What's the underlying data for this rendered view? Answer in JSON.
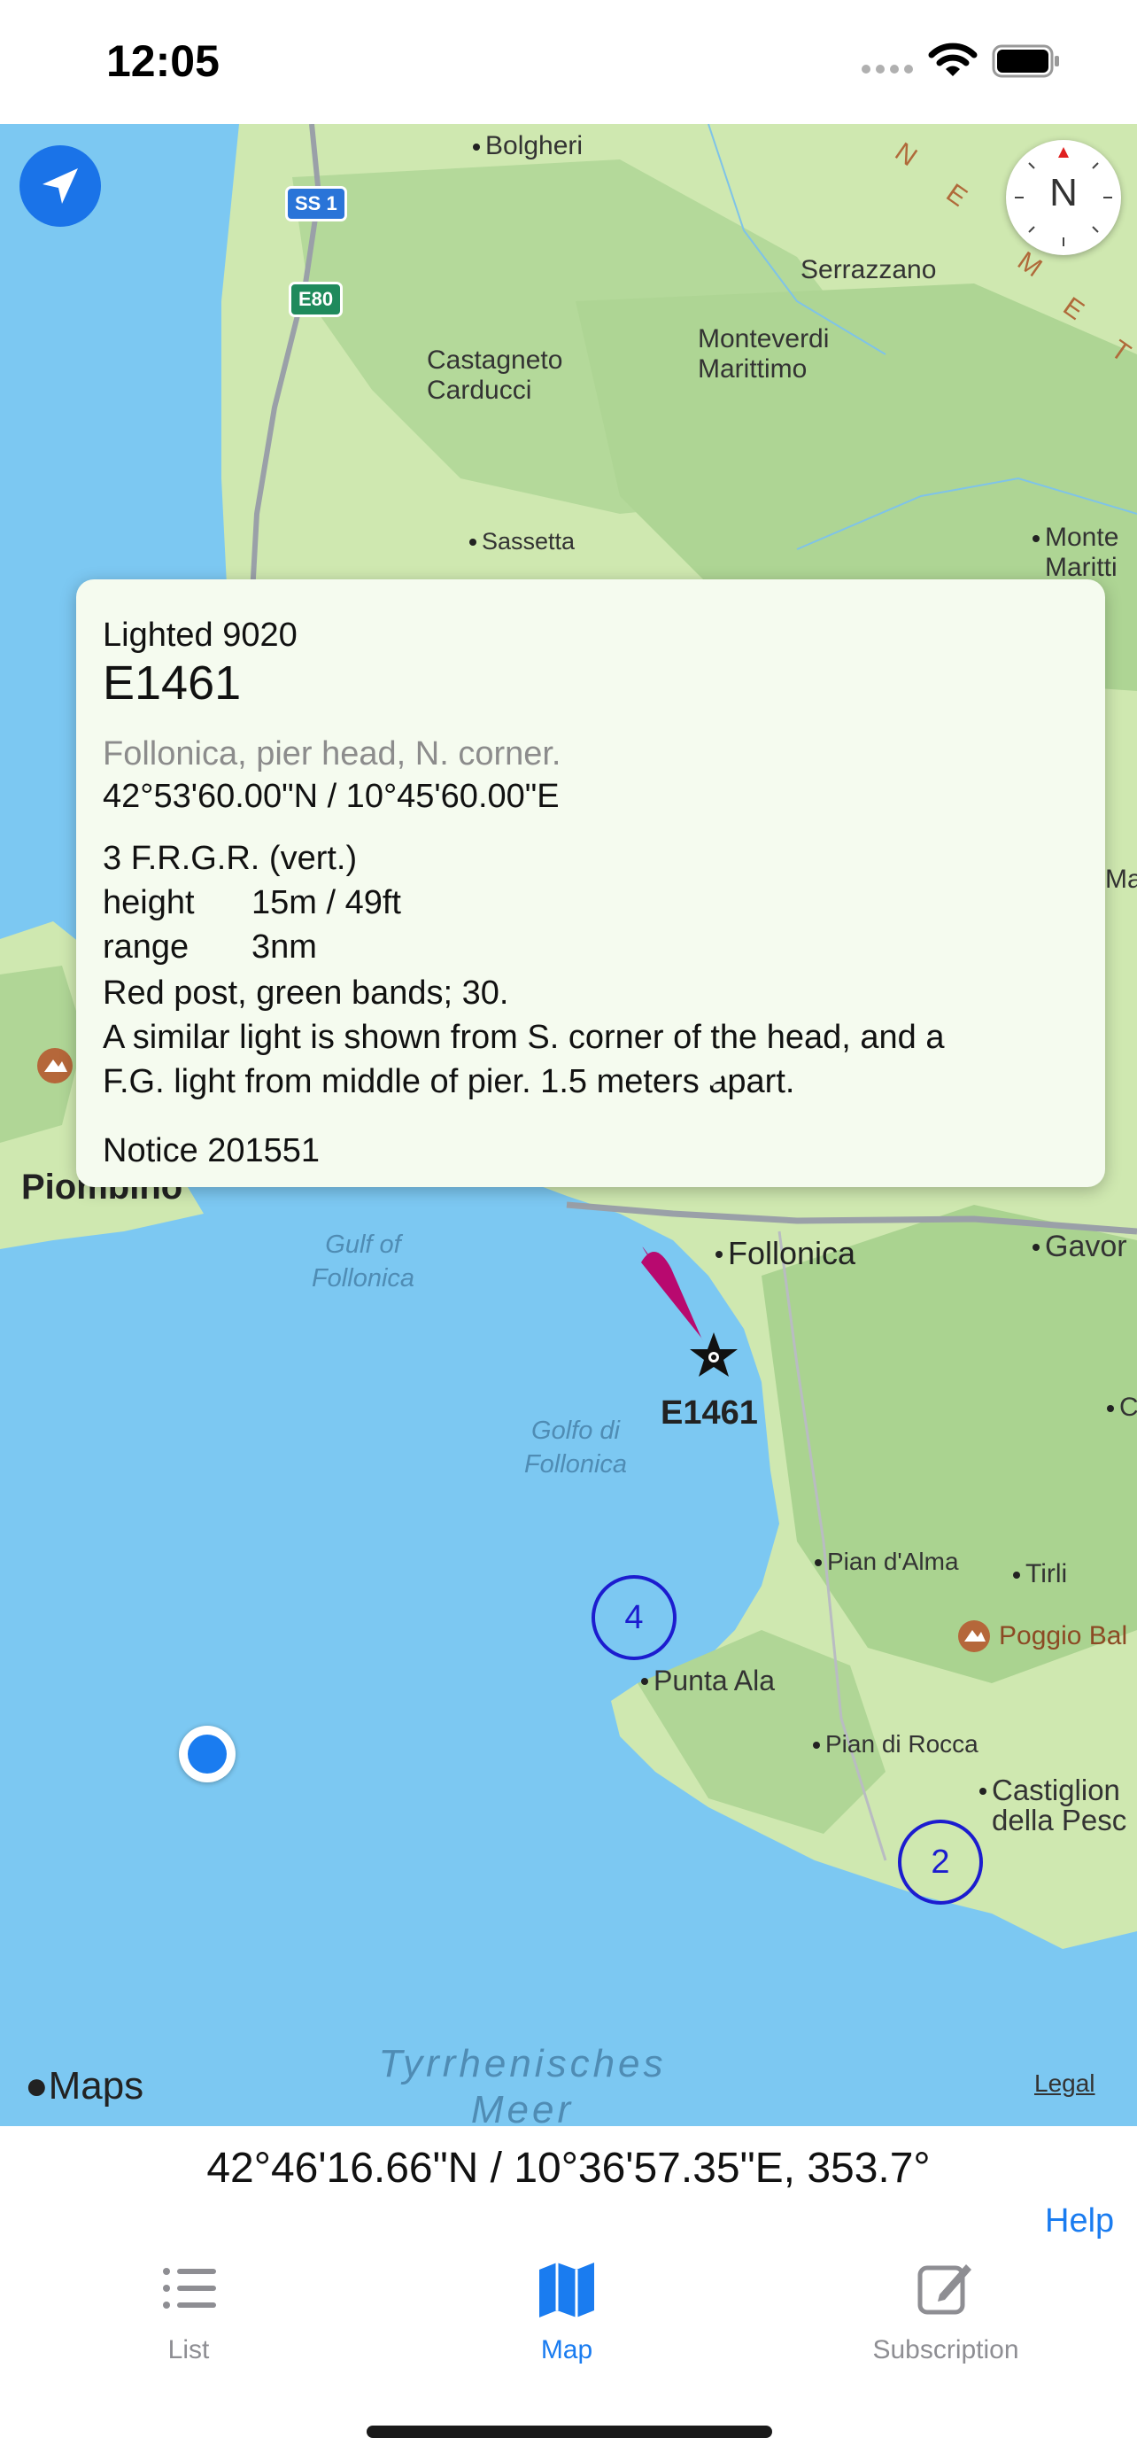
{
  "status_bar": {
    "time": "12:05"
  },
  "map": {
    "places": [
      {
        "name": "Bolgheri"
      },
      {
        "name": "Serrazzano"
      },
      {
        "name": "Castagneto\nCarducci"
      },
      {
        "name": "Monteverdi\nMarittimo"
      },
      {
        "name": "Sassetta"
      },
      {
        "name": "Monte\nMaritti"
      },
      {
        "name": "Follonica"
      },
      {
        "name": "Gavor"
      },
      {
        "name": "Pian d'Alma"
      },
      {
        "name": "Tirli"
      },
      {
        "name": "Poggio Bal"
      },
      {
        "name": "Punta Ala"
      },
      {
        "name": "Pian di Rocca"
      },
      {
        "name": "Castiglion\ndella Pesc"
      },
      {
        "name": "Ma"
      },
      {
        "name": "C"
      }
    ],
    "region_letters": [
      "N",
      "E",
      "M",
      "E",
      "T"
    ],
    "piombino": "Piombino",
    "water_labels": [
      "Gulf of\nFollonica",
      "Golfo di\nFollonica",
      "Tyrrhenisches\nMeer"
    ],
    "road_shields": [
      "SS 1",
      "E80"
    ],
    "compass_label": "N",
    "marker_label": "E1461",
    "clusters": [
      "4",
      "2"
    ],
    "maps_attribution": "Maps",
    "legal": "Legal"
  },
  "popup": {
    "type": "Lighted 9020",
    "id": "E1461",
    "location": "Follonica, pier head, N. corner.",
    "coordinates": "42°53'60.00\"N / 10°45'60.00\"E",
    "characteristic": "3 F.R.G.R. (vert.)",
    "height_label": "height",
    "height_value": "15m / 49ft",
    "range_label": "range",
    "range_value": "3nm",
    "structure": "Red post, green bands; 30.",
    "remarks_1": "A similar light is shown from S. corner of the head, and a",
    "remarks_2": "F.G. light from middle of pier. 1.5 meters apart.",
    "notice": "Notice 201551"
  },
  "bottom": {
    "coords_readout": "42°46'16.66\"N / 10°36'57.35\"E, 353.7°",
    "help": "Help"
  },
  "tabs": [
    {
      "label": "List",
      "icon": "list-icon",
      "active": false
    },
    {
      "label": "Map",
      "icon": "map-icon",
      "active": true
    },
    {
      "label": "Subscription",
      "icon": "compose-icon",
      "active": false
    }
  ],
  "colors": {
    "accent": "#1a7cf0",
    "land": "#cfe8b0",
    "forest": "#a9d38a",
    "water": "#7cc8f2",
    "marker": "#b8096f"
  }
}
